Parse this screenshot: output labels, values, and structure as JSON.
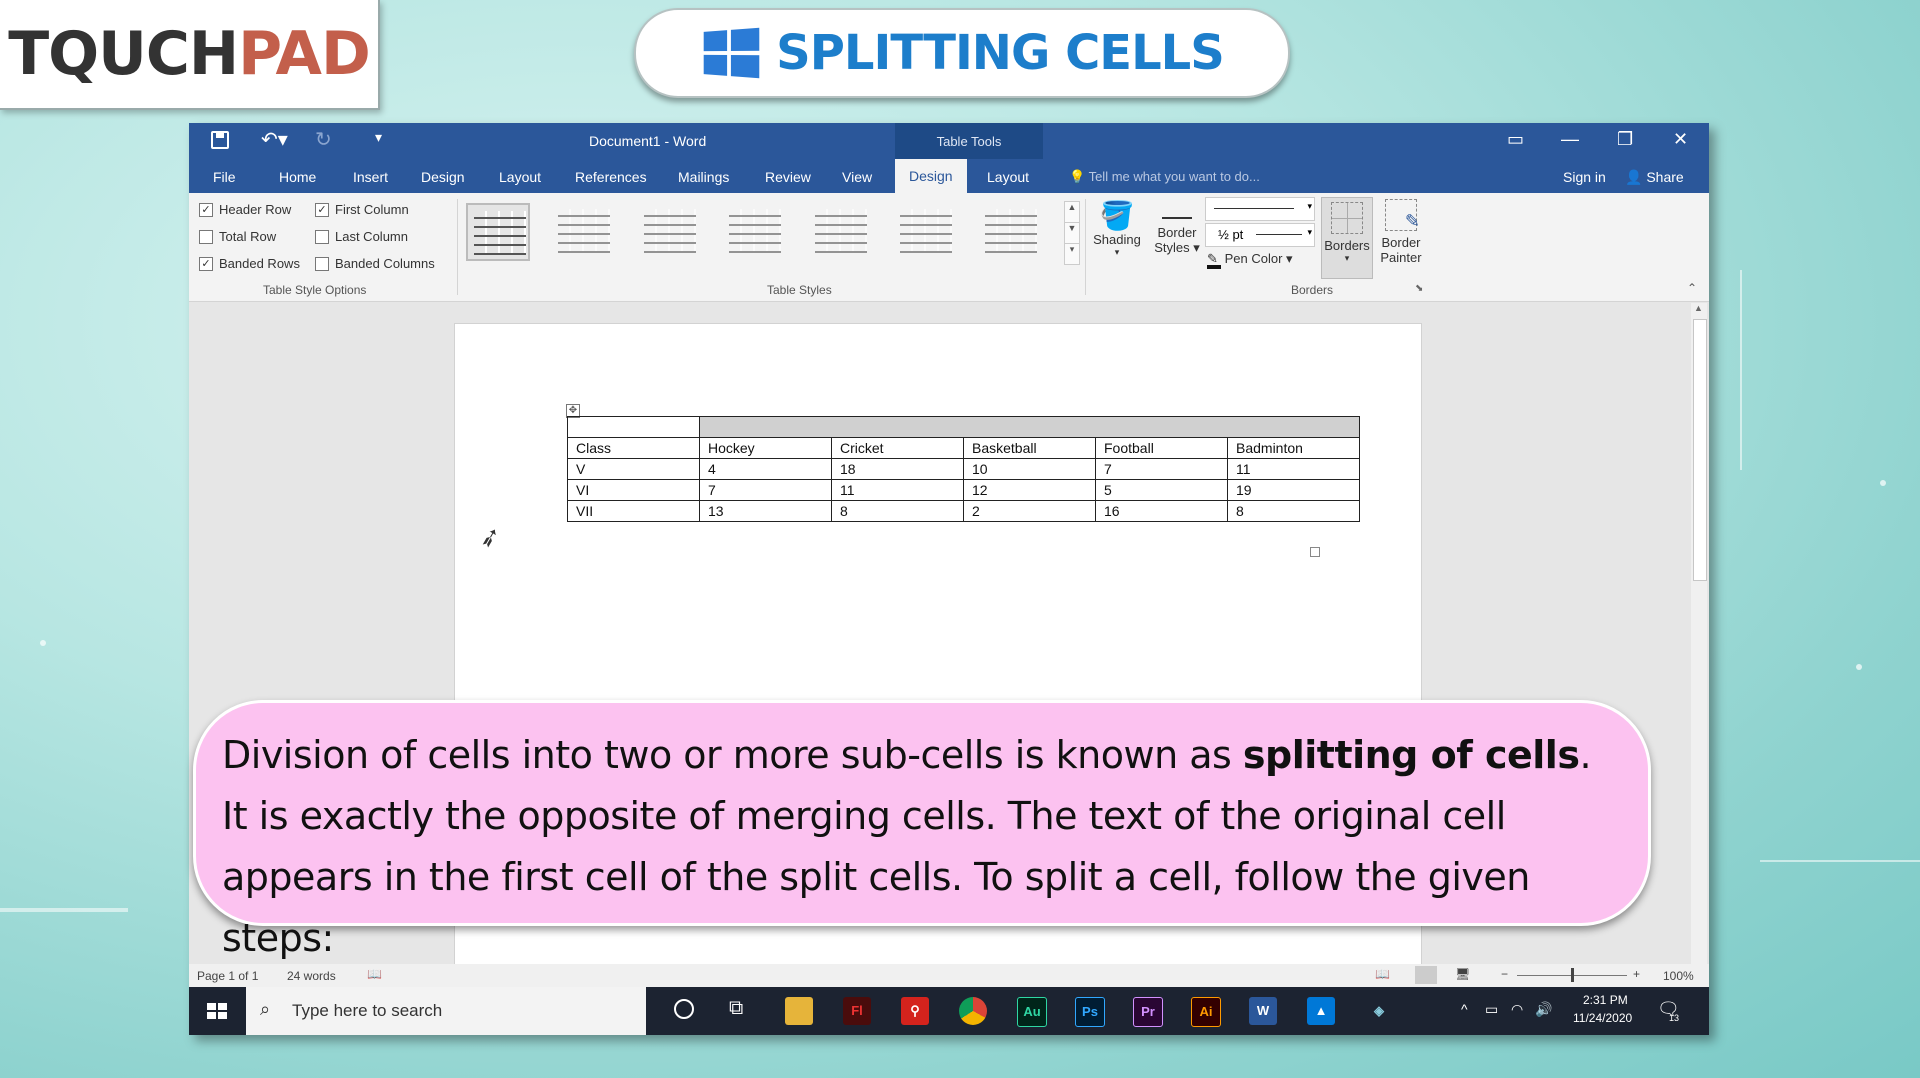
{
  "logo": {
    "part1": "TQUCH",
    "part2": "PAD"
  },
  "slide_title": "SPLITTING CELLS",
  "word": {
    "doc_title": "Document1 - Word",
    "context_tab_group": "Table Tools",
    "tabs": [
      "File",
      "Home",
      "Insert",
      "Design",
      "Layout",
      "References",
      "Mailings",
      "Review",
      "View",
      "Design",
      "Layout"
    ],
    "active_tab_index": 9,
    "tell_me_placeholder": "Tell me what you want to do...",
    "sign_in": "Sign in",
    "share": "Share",
    "ribbon": {
      "style_options": [
        {
          "label": "Header Row",
          "checked": true
        },
        {
          "label": "First Column",
          "checked": true
        },
        {
          "label": "Total Row",
          "checked": false
        },
        {
          "label": "Last Column",
          "checked": false
        },
        {
          "label": "Banded Rows",
          "checked": true
        },
        {
          "label": "Banded Columns",
          "checked": false
        }
      ],
      "group_table_style_options": "Table Style Options",
      "group_table_styles": "Table Styles",
      "group_borders": "Borders",
      "shading": "Shading",
      "border_styles_1": "Border",
      "border_styles_2": "Styles",
      "pen_weight": "½ pt",
      "pen_color": "Pen Color",
      "borders": "Borders",
      "border_painter_1": "Border",
      "border_painter_2": "Painter"
    },
    "table": {
      "header": [
        "Class",
        "Hockey",
        "Cricket",
        "Basketball",
        "Football",
        "Badminton"
      ],
      "rows": [
        [
          "V",
          "4",
          "18",
          "10",
          "7",
          "11"
        ],
        [
          "VI",
          "7",
          "11",
          "12",
          "5",
          "19"
        ],
        [
          "VII",
          "13",
          "8",
          "2",
          "16",
          "8"
        ]
      ]
    },
    "status": {
      "page": "Page 1 of 1",
      "words": "24 words",
      "zoom": "100%"
    }
  },
  "taskbar": {
    "search_placeholder": "Type here to search",
    "time": "2:31 PM",
    "date": "11/24/2020",
    "notifications": "13",
    "apps": [
      "Fl",
      "Au",
      "Ps",
      "Pr",
      "Ai"
    ]
  },
  "caption": {
    "part1": "Division of cells into two or more sub-cells is known as ",
    "bold": "splitting of cells",
    "part2": ". It is exactly the opposite of merging cells. The text of the original cell appears in the first cell of the split cells. To split a cell, follow the given steps:"
  },
  "colors": {
    "word_blue": "#2b579a",
    "title_blue": "#1d7ecb",
    "caption_pink": "#fcc2f0",
    "logo_orange": "#c35f4b"
  }
}
